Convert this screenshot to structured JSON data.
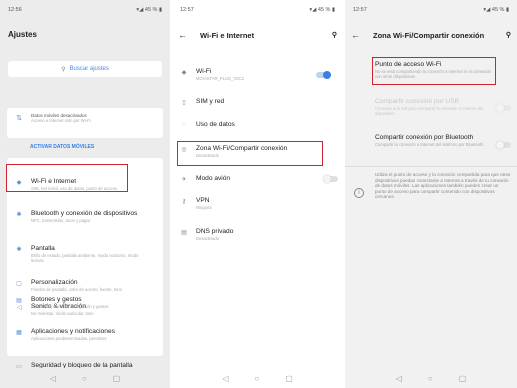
{
  "screen1": {
    "time": "12:56",
    "status": "45 %",
    "title": "Ajustes",
    "search_placeholder": "Buscar ajustes",
    "data_card": {
      "title": "Datos móviles desactivados",
      "subtitle": "Acceso a Internet solo por Wi-Fi",
      "action": "ACTIVAR DATOS MÓVILES"
    },
    "items": [
      {
        "title": "Wi-Fi e Internet",
        "subtitle": "SIM, red móvil, uso de datos, punto de acceso",
        "icon": "wifi-icon"
      },
      {
        "title": "Bluetooth y conexión de dispositivos",
        "subtitle": "NFC, transmisión, tocar y pagar",
        "icon": "bluetooth-icon"
      },
      {
        "title": "Pantalla",
        "subtitle": "Brillo de estado, pantalla ambiente, modo nocturno, modo lectura",
        "icon": "brightness-icon"
      },
      {
        "title": "Personalización",
        "subtitle": "Fondos de pantalla, color de acento, fuente, tono",
        "icon": "palette-icon"
      },
      {
        "title": "Sonido & vibración",
        "subtitle": "No molestar, modo auricular, tono",
        "icon": "sound-icon"
      },
      {
        "title": "Botones y gestos",
        "subtitle": "Alert Slider, barra de navegación y gestos",
        "icon": "gesture-icon"
      },
      {
        "title": "Aplicaciones y notificaciones",
        "subtitle": "Aplicaciones predeterminadas, permisos",
        "icon": "apps-icon"
      },
      {
        "title": "Seguridad y bloqueo de la pantalla",
        "subtitle": "",
        "icon": "lock-icon"
      }
    ]
  },
  "screen2": {
    "time": "12:57",
    "status": "45 %",
    "title": "Wi-Fi e Internet",
    "items": [
      {
        "title": "Wi-Fi",
        "subtitle": "MOVISTAR_PLUS_7DC3",
        "icon": "wifi-icon"
      },
      {
        "title": "SIM y red",
        "subtitle": "",
        "icon": "sim-icon"
      },
      {
        "title": "Uso de datos",
        "subtitle": "",
        "icon": "data-usage-icon"
      },
      {
        "title": "Zona Wi-Fi/Compartir conexión",
        "subtitle": "Desactivado",
        "icon": "hotspot-icon"
      },
      {
        "title": "Modo avión",
        "subtitle": "",
        "icon": "airplane-icon"
      },
      {
        "title": "VPN",
        "subtitle": "Ninguna",
        "icon": "vpn-icon"
      },
      {
        "title": "DNS privado",
        "subtitle": "Desactivado",
        "icon": "dns-icon"
      }
    ]
  },
  "screen3": {
    "time": "12:57",
    "status": "45 %",
    "title": "Zona Wi-Fi/Compartir conexión",
    "items": [
      {
        "title": "Punto de acceso Wi-Fi",
        "subtitle": "No se está compartiendo la conexión a Internet ni el contenido con otros dispositivos"
      },
      {
        "title": "Compartir conexión por USB",
        "subtitle": "Conectar a la red para compartir la conexión a Internet del dispositivo"
      },
      {
        "title": "Compartir conexión por Bluetooth",
        "subtitle": "Compartir la conexión a Internet del teléfono por Bluetooth"
      }
    ],
    "info": "Utiliza el punto de acceso y la conexión compartida para que otros dispositivos puedan conectarse a Internet a través de tu conexión de datos móviles. Las aplicaciones también pueden crear un punto de acceso para compartir contenido con dispositivos cercanos."
  },
  "colors": {
    "accent": "#3a7ee4",
    "highlight": "#cf2130"
  }
}
